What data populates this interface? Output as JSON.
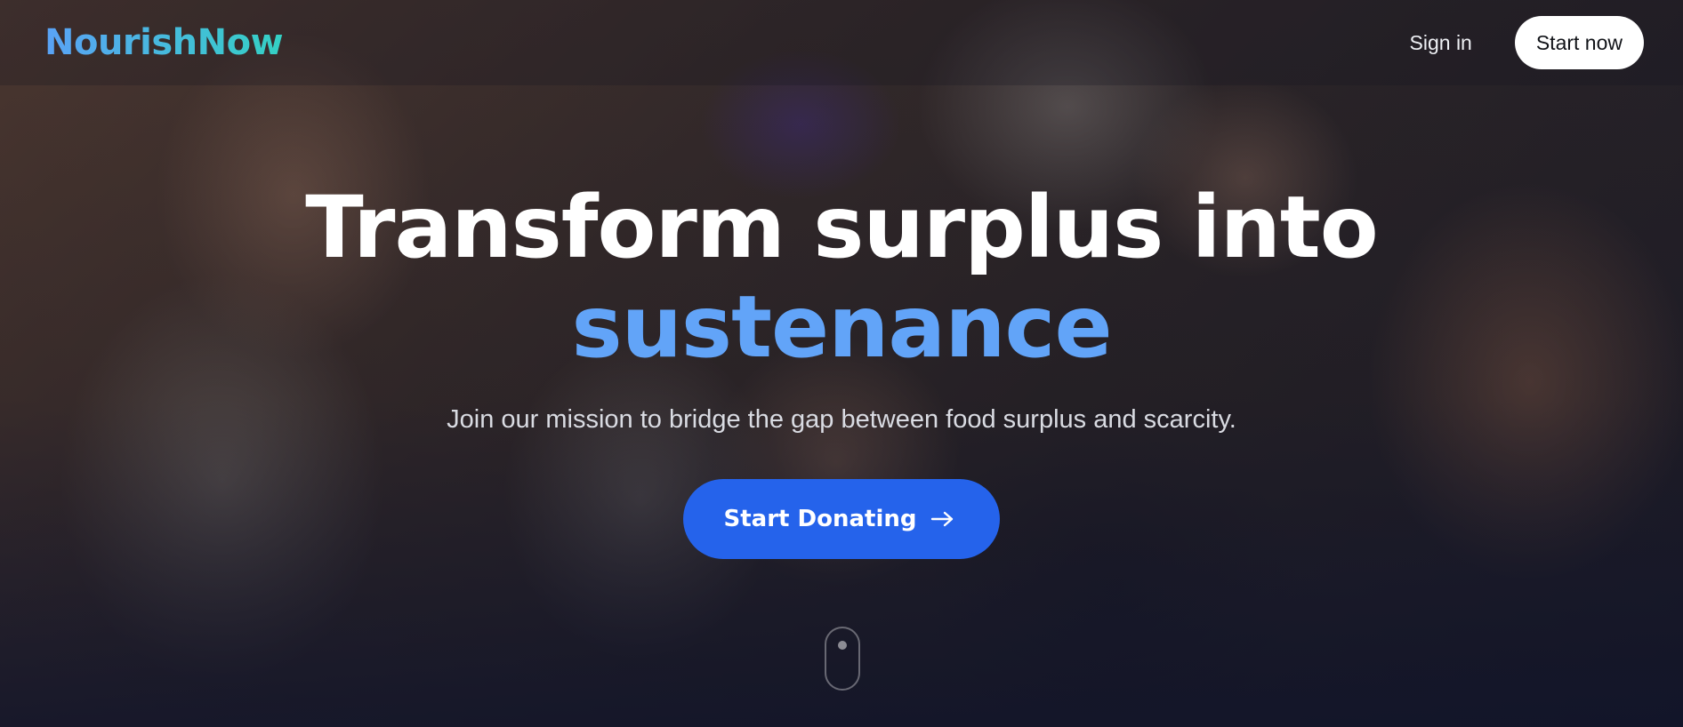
{
  "nav": {
    "logo": "NourishNow",
    "signin_label": "Sign in",
    "startnow_label": "Start now"
  },
  "hero": {
    "headline_line1": "Transform surplus into",
    "headline_accent": "sustenance",
    "subtitle": "Join our mission to bridge the gap between food surplus and scarcity.",
    "cta_label": "Start Donating",
    "cta_icon": "arrow-right-icon",
    "scroll_icon": "mouse-scroll-icon"
  },
  "colors": {
    "accent": "#62a4f8",
    "cta": "#2563eb",
    "logo_gradient_start": "#5aa2f6",
    "logo_gradient_end": "#34d1c4"
  }
}
